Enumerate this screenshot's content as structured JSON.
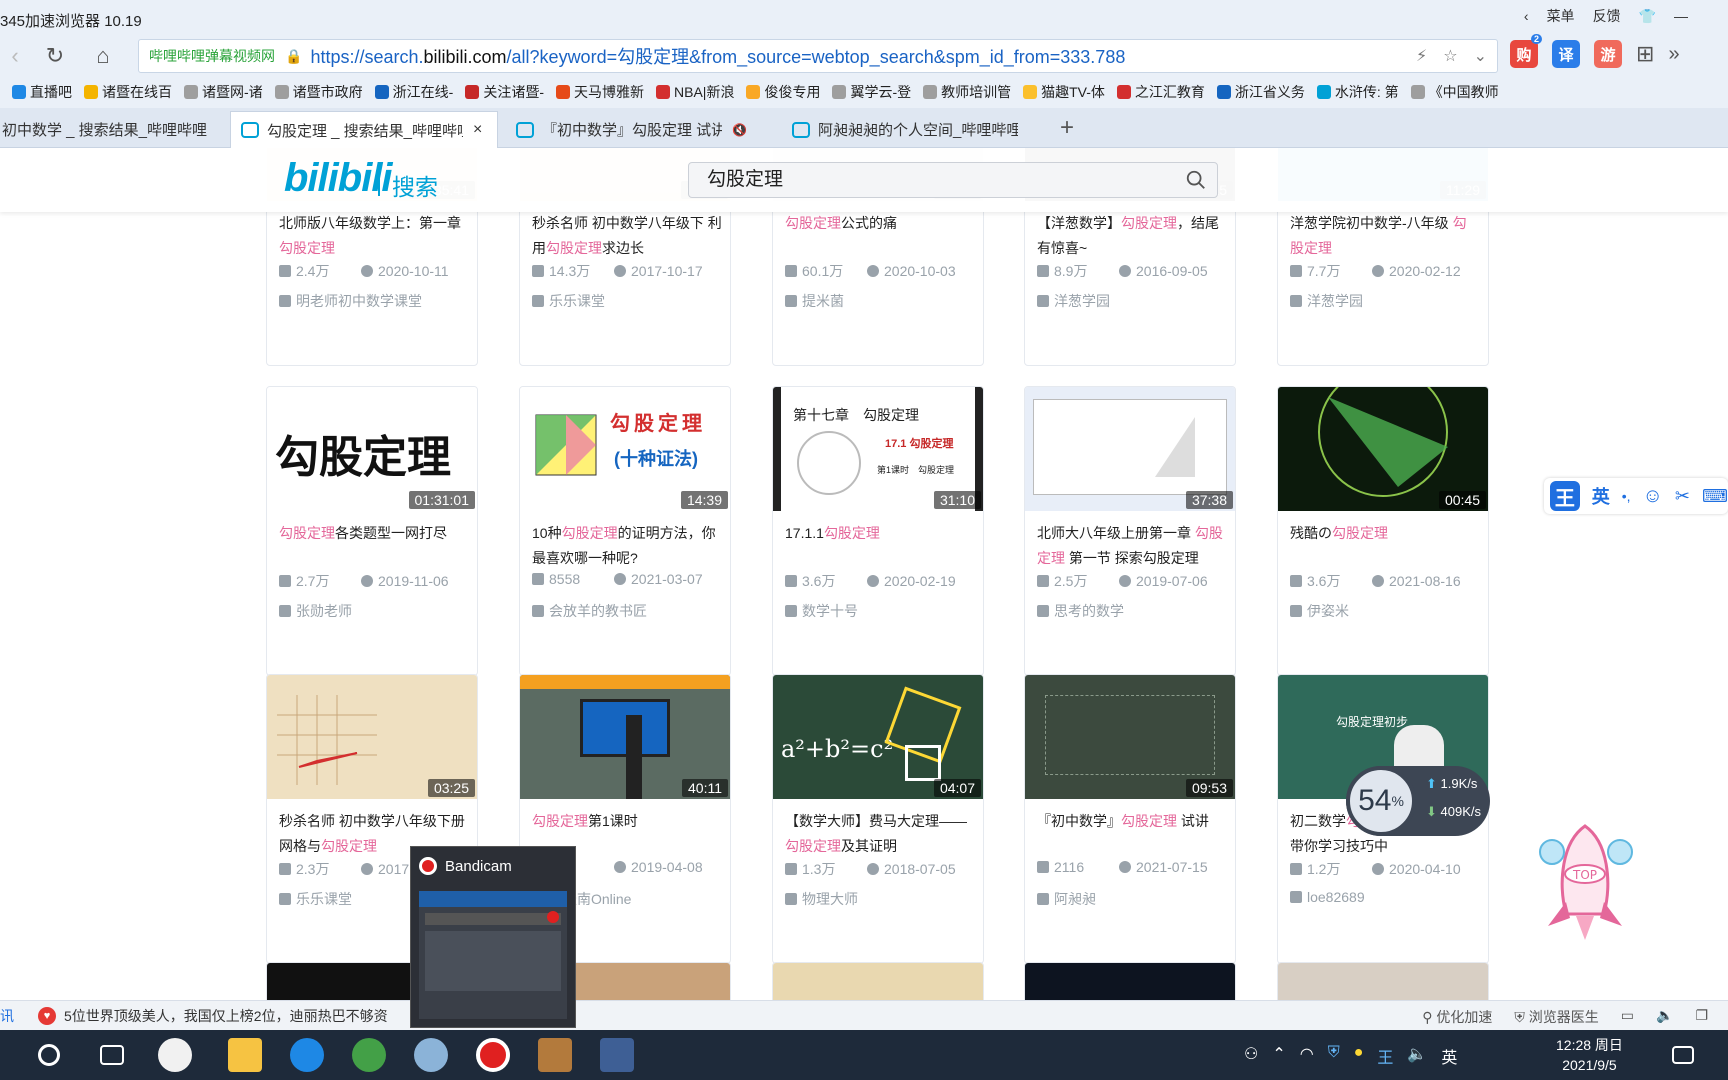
{
  "browser": {
    "title": "345加速浏览器 10.19",
    "menu_label": "菜单",
    "feedback_label": "反馈",
    "site_label": "哔哩哔哩弹幕视频网",
    "url_prefix": "https://search.",
    "url_host": "bilibili.com",
    "url_rest": "/all?keyword=勾股定理&from_source=webtop_search&spm_id_from=333.788",
    "nav_apps": [
      {
        "label": "购",
        "badge": "2",
        "color": "#e8473e"
      },
      {
        "label": "译",
        "color": "#2b7de9"
      },
      {
        "label": "游",
        "color": "#f06a5c"
      }
    ]
  },
  "bookmarks": [
    {
      "label": "直播吧",
      "color": "#1e88e5"
    },
    {
      "label": "诸暨在线百",
      "color": "#f4b400"
    },
    {
      "label": "诸暨网-诸",
      "color": "#9e9e9e"
    },
    {
      "label": "诸暨市政府",
      "color": "#9e9e9e"
    },
    {
      "label": "浙江在线-",
      "color": "#1565c0"
    },
    {
      "label": "关注诸暨-",
      "color": "#c62828"
    },
    {
      "label": "天马博雅新",
      "color": "#e64a19"
    },
    {
      "label": "NBA|新浪",
      "color": "#d32f2f"
    },
    {
      "label": "俊俊专用",
      "color": "#f9a825"
    },
    {
      "label": "翼学云-登",
      "color": "#9e9e9e"
    },
    {
      "label": "教师培训管",
      "color": "#9e9e9e"
    },
    {
      "label": "猫趣TV-体",
      "color": "#fbc02d"
    },
    {
      "label": "之江汇教育",
      "color": "#d32f2f"
    },
    {
      "label": "浙江省义务",
      "color": "#1565c0"
    },
    {
      "label": "水浒传: 第",
      "color": "#00a1d6"
    },
    {
      "label": "《中国教师",
      "color": "#9e9e9e"
    }
  ],
  "tabs": [
    {
      "label": "初中数学 _ 搜索结果_哔哩哔哩",
      "active": false
    },
    {
      "label": "勾股定理 _ 搜索结果_哔哩哔哩",
      "active": true,
      "close": "×"
    },
    {
      "label": "『初中数学』勾股定理 试讲",
      "active": false,
      "mute": "🔇"
    },
    {
      "label": "阿昶昶昶的个人空间_哔哩哔哩",
      "active": false
    }
  ],
  "new_tab": "+",
  "site": {
    "logo": "bilibili",
    "logo_sub": "搜索",
    "search_value": "勾股定理"
  },
  "videos_row1": [
    {
      "dur": "01:35:41",
      "t1": "北师版八年级数学上：第一章 ",
      "kw": "勾股定理",
      "t2": "",
      "views": "2.4万",
      "date": "2020-10-11",
      "up": "明老师初中数学课堂"
    },
    {
      "dur": "02:44",
      "t1": "秒杀名师 初中数学八年级下 利用",
      "kw": "勾股定理",
      "t2": "求边长",
      "views": "14.3万",
      "date": "2017-10-17",
      "up": "乐乐课堂"
    },
    {
      "dur": "00:33",
      "t1": "",
      "kw": "勾股定理",
      "t2": "公式的痛",
      "views": "60.1万",
      "date": "2020-10-03",
      "up": "提米菌"
    },
    {
      "dur": "10:15",
      "t1": "【洋葱数学】",
      "kw": "勾股定理",
      "t2": "，结尾有惊喜~",
      "views": "8.9万",
      "date": "2016-09-05",
      "up": "洋葱学园"
    },
    {
      "dur": "11:29",
      "t1": "洋葱学院初中数学-八年级 ",
      "kw": "勾股定理",
      "t2": "",
      "views": "7.7万",
      "date": "2020-02-12",
      "up": "洋葱学园"
    }
  ],
  "videos_row2": [
    {
      "dur": "01:31:01",
      "thumb_text": "勾股定理",
      "t1": "",
      "kw": "勾股定理",
      "t2": "各类题型一网打尽",
      "views": "2.7万",
      "date": "2019-11-06",
      "up": "张勋老师"
    },
    {
      "dur": "14:39",
      "thumb_text": "勾股定理",
      "thumb_sub": "(十种证法)",
      "t1": "10种",
      "kw": "勾股定理",
      "t2": "的证明方法，你最喜欢哪一种呢?",
      "views": "8558",
      "date": "2021-03-07",
      "up": "会放羊的教书匠"
    },
    {
      "dur": "31:10",
      "thumb_text": "第十七章　勾股定理",
      "thumb_sub": "17.1 勾股定理",
      "thumb_sub2": "第1课时　勾股定理",
      "t1": "17.1.1",
      "kw": "勾股定理",
      "t2": "",
      "views": "3.6万",
      "date": "2020-02-19",
      "up": "数学十号"
    },
    {
      "dur": "37:38",
      "t1": "北师大八年级上册第一章 ",
      "kw": "勾股定理",
      "t2": " 第一节 探索勾股定理",
      "views": "2.5万",
      "date": "2019-07-06",
      "up": "思考的数学"
    },
    {
      "dur": "00:45",
      "t1": "残酷の",
      "kw": "勾股定理",
      "t2": "",
      "views": "3.6万",
      "date": "2021-08-16",
      "up": "伊姿米"
    }
  ],
  "videos_row3": [
    {
      "dur": "03:25",
      "t1": "秒杀名师 初中数学八年级下册 网格与",
      "kw": "勾股定理",
      "t2": "",
      "views": "2.3万",
      "date": "2017",
      "up": "乐乐课堂"
    },
    {
      "dur": "40:11",
      "t1": "",
      "kw": "勾股定理",
      "t2": "第1课时",
      "views": "4",
      "date": "2019-04-08",
      "up": "南天南Online"
    },
    {
      "dur": "04:07",
      "thumb_text": "a²+b²=c²",
      "t1": "【数学大师】费马大定理——",
      "kw": "勾股定理",
      "t2": "及其证明",
      "views": "1.3万",
      "date": "2018-07-05",
      "up": "物理大师"
    },
    {
      "dur": "09:53",
      "t1": "『初中数学』",
      "kw": "勾股定理",
      "t2": " 试讲",
      "views": "2116",
      "date": "2021-07-15",
      "up": "阿昶昶"
    },
    {
      "dur": "",
      "thumb_text": "勾股定理初步",
      "t1": "初二数学",
      "kw": "勾股定理",
      "t2": "总结讲解，带你学习技巧中",
      "views": "1.2万",
      "date": "2020-04-10",
      "up": "loe82689"
    }
  ],
  "ime": {
    "w": "王",
    "lang": "英",
    "dot": "•,",
    "emoji": "☺",
    "tool": "✂",
    "kbd": "⌨"
  },
  "speed": {
    "pct": "54",
    "unit": "%",
    "up": "1.9K/s",
    "down": "409K/s"
  },
  "rocket": {
    "label": "TOP"
  },
  "bandicam": {
    "title": "Bandicam"
  },
  "news": {
    "heart": "♥",
    "prefix": "讯",
    "text": "5位世界顶级美人，我国仅上榜2位，迪丽热巴不够资"
  },
  "status": {
    "accel": "优化加速",
    "doctor": "浏览器医生"
  },
  "clock": {
    "time": "12:28 周日",
    "date": "2021/9/5"
  },
  "tray": {
    "lang": "英",
    "ime": "王"
  }
}
